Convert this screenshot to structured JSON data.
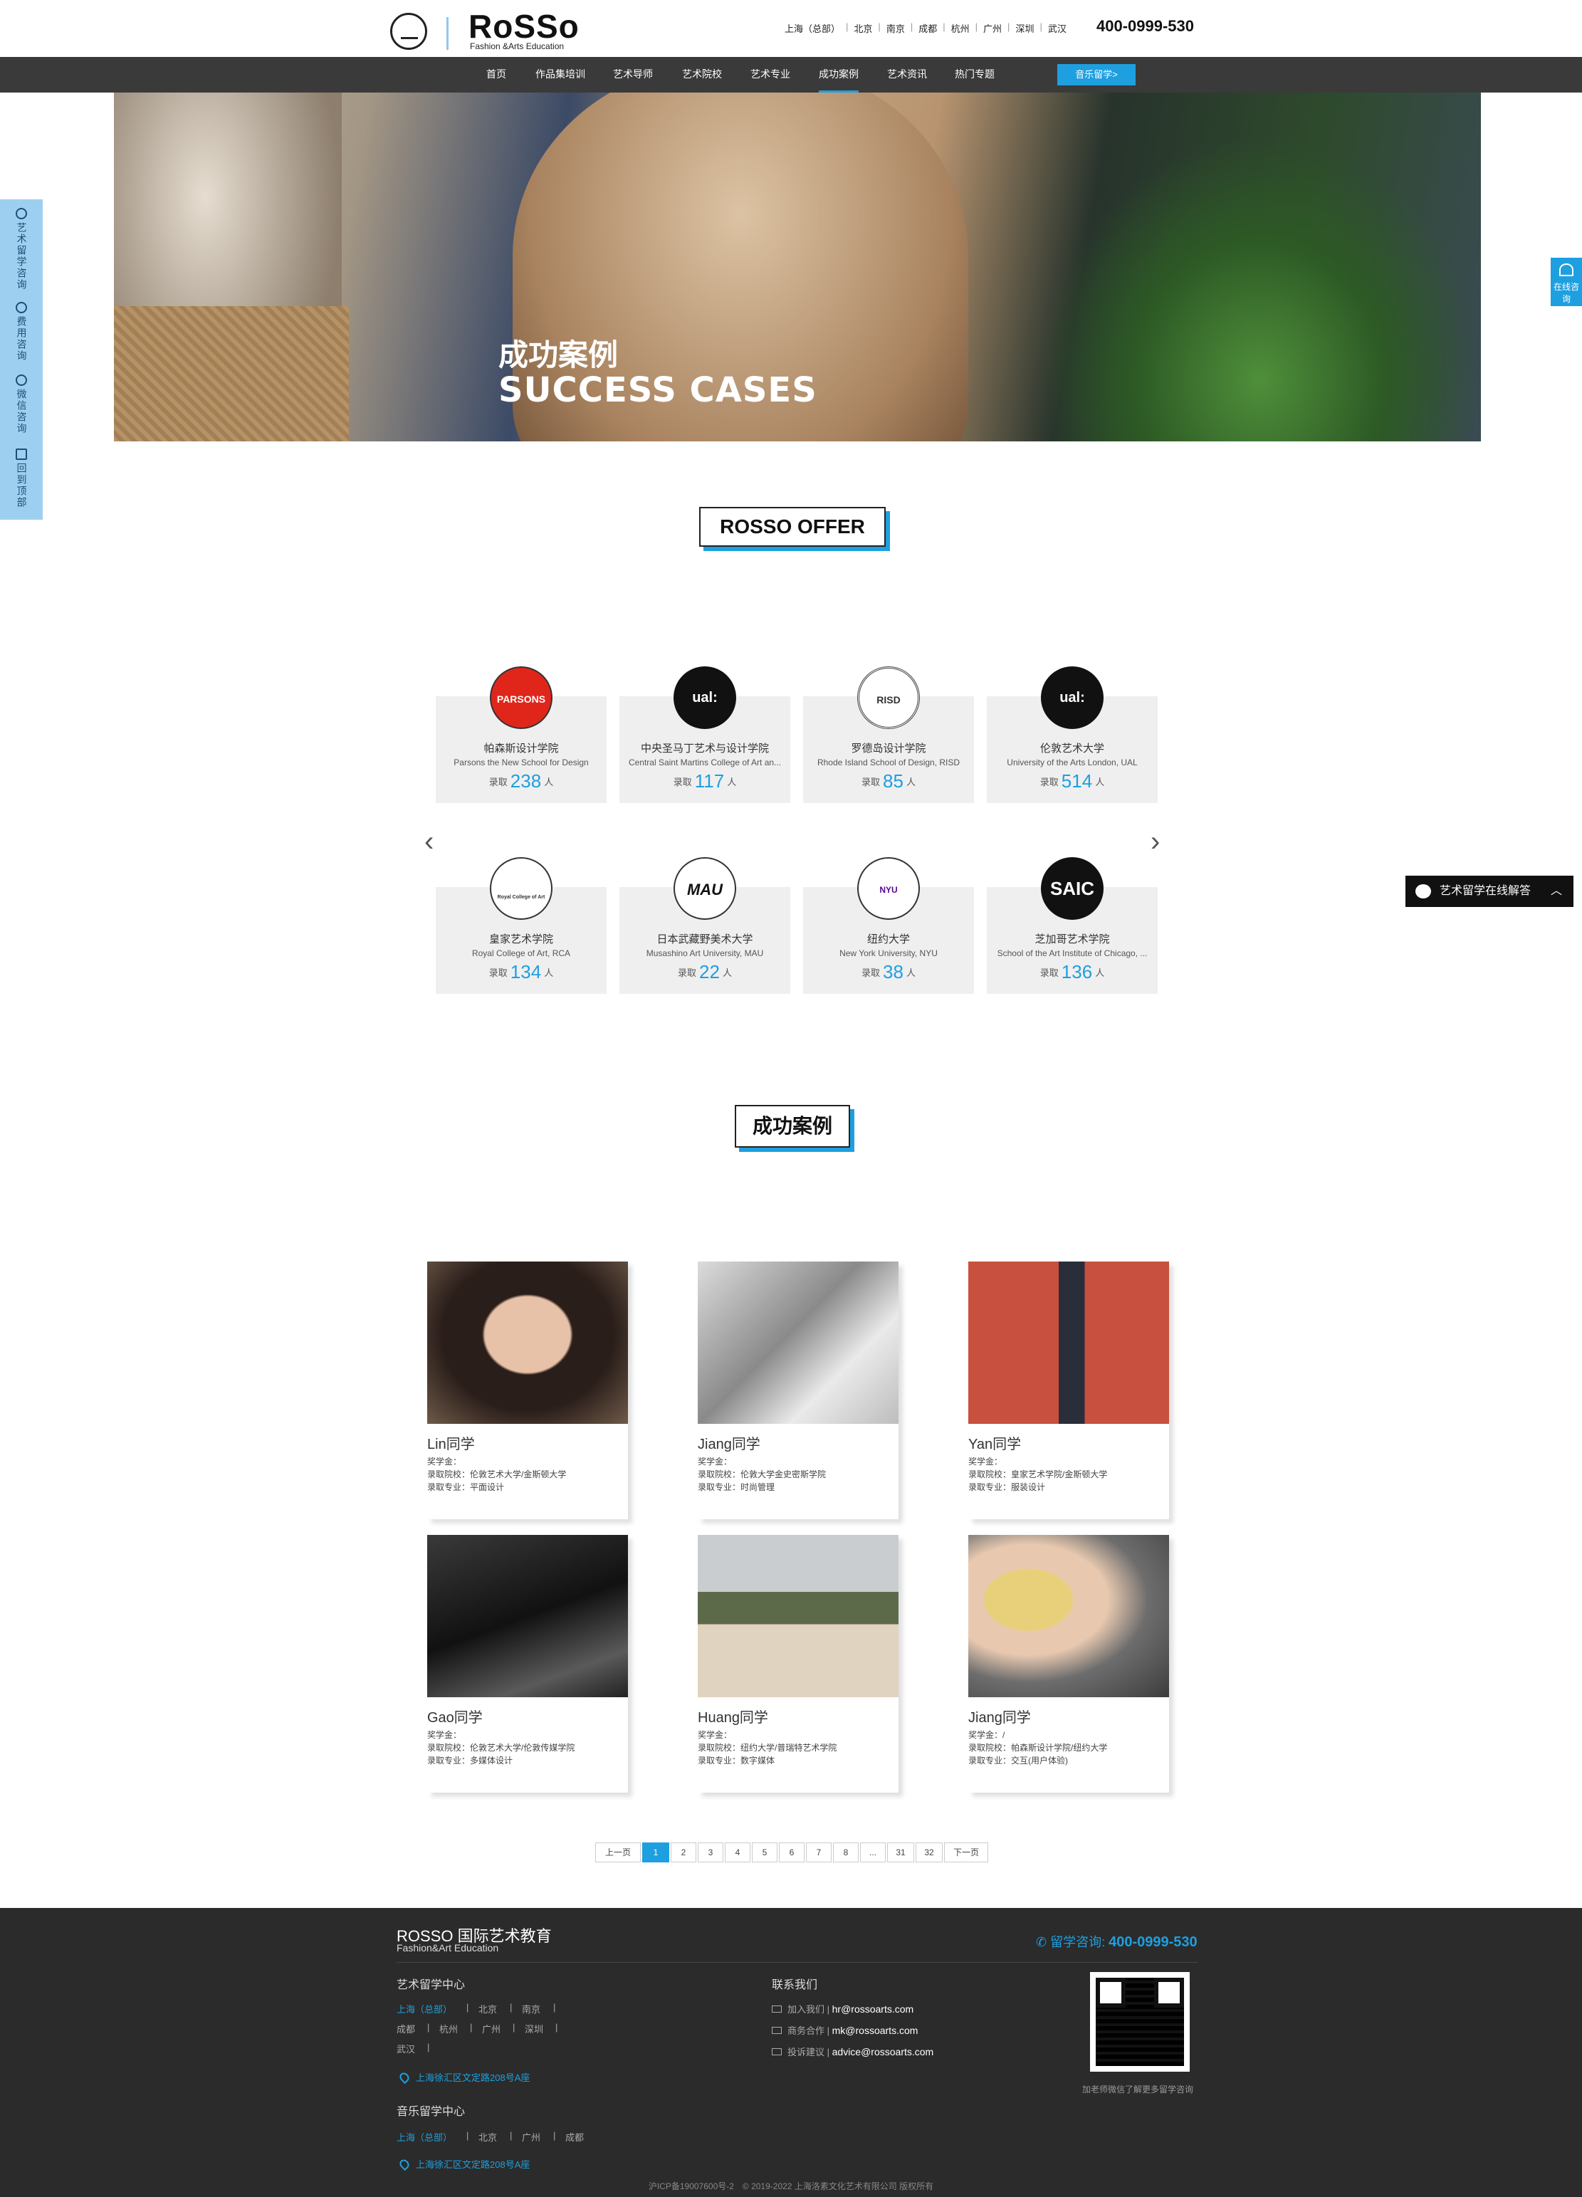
{
  "header": {
    "logo_text": "RoSSo",
    "logo_sub": "Fashion &Arts Education",
    "cities": [
      "上海（总部）",
      "北京",
      "南京",
      "成都",
      "杭州",
      "广州",
      "深圳",
      "武汉"
    ],
    "phone": "400-0999-530"
  },
  "nav": {
    "items": [
      "首页",
      "作品集培训",
      "艺术导师",
      "艺术院校",
      "艺术专业",
      "成功案例",
      "艺术资讯",
      "热门专题"
    ],
    "active_index": 5,
    "music_button": "音乐留学>"
  },
  "hero": {
    "title_cn": "成功案例",
    "title_en": "SUCCESS CASES"
  },
  "sidebar_left": [
    "艺术留学咨询",
    "费用咨询",
    "微信咨询",
    "回到顶部"
  ],
  "sidebar_right": {
    "label": "在线咨询"
  },
  "chat_widget": {
    "label": "艺术留学在线解答",
    "toggle": "︿"
  },
  "offer_section": {
    "title": "ROSSO OFFER",
    "count_prefix": "录取",
    "count_suffix": "人",
    "schools": [
      {
        "cn": "帕森斯设计学院",
        "en": "Parsons the New School for Design",
        "count": "238",
        "logo_text": "PARSONS"
      },
      {
        "cn": "中央圣马丁艺术与设计学院",
        "en": "Central Saint Martins College of Art an...",
        "count": "117",
        "logo_text": "ual:"
      },
      {
        "cn": "罗德岛设计学院",
        "en": "Rhode Island School of Design, RISD",
        "count": "85",
        "logo_text": "RISD"
      },
      {
        "cn": "伦敦艺术大学",
        "en": "University of the Arts London, UAL",
        "count": "514",
        "logo_text": "ual:"
      },
      {
        "cn": "皇家艺术学院",
        "en": "Royal College of Art, RCA",
        "count": "134",
        "logo_text": "Royal College of Art"
      },
      {
        "cn": "日本武藏野美术大学",
        "en": "Musashino Art University, MAU",
        "count": "22",
        "logo_text": "MAU"
      },
      {
        "cn": "纽约大学",
        "en": "New York University, NYU",
        "count": "38",
        "logo_text": "NYU"
      },
      {
        "cn": "芝加哥艺术学院",
        "en": "School of the Art Institute of Chicago, ...",
        "count": "136",
        "logo_text": "SAIC"
      }
    ],
    "prev_arrow": "‹",
    "next_arrow": "›"
  },
  "cases_section": {
    "title": "成功案例",
    "cases": [
      {
        "name": "Lin同学",
        "scholarship": "奖学金：",
        "school": "录取院校：伦敦艺术大学/金斯顿大学",
        "major": "录取专业：平面设计"
      },
      {
        "name": "Jiang同学",
        "scholarship": "奖学金：",
        "school": "录取院校：伦敦大学金史密斯学院",
        "major": "录取专业：时尚管理"
      },
      {
        "name": "Yan同学",
        "scholarship": "奖学金：",
        "school": "录取院校：皇家艺术学院/金斯顿大学",
        "major": "录取专业：服装设计"
      },
      {
        "name": "Gao同学",
        "scholarship": "奖学金：",
        "school": "录取院校：伦敦艺术大学/伦敦传媒学院",
        "major": "录取专业：多媒体设计"
      },
      {
        "name": "Huang同学",
        "scholarship": "奖学金：",
        "school": "录取院校：纽约大学/普瑞特艺术学院",
        "major": "录取专业：数字媒体"
      },
      {
        "name": "Jiang同学",
        "scholarship": "奖学金：/",
        "school": "录取院校：帕森斯设计学院/纽约大学",
        "major": "录取专业：交互(用户体验)"
      }
    ]
  },
  "pagination": {
    "prev": "上一页",
    "pages": [
      "1",
      "2",
      "3",
      "4",
      "5",
      "6",
      "7",
      "8",
      "...",
      "31",
      "32"
    ],
    "current": "1",
    "next": "下一页"
  },
  "footer": {
    "brand": "ROSSO 国际艺术教育",
    "brand_sub": "Fashion&Art Education",
    "hotline_label": "留学咨询:",
    "hotline": "400-0999-530",
    "art_center_title": "艺术留学中心",
    "art_cities": [
      "上海（总部）",
      "北京",
      "南京",
      "成都",
      "杭州",
      "广州",
      "深圳",
      "武汉"
    ],
    "art_address": "上海徐汇区文定路208号A座",
    "music_center_title": "音乐留学中心",
    "music_cities": [
      "上海（总部）",
      "北京",
      "广州",
      "成都"
    ],
    "music_address": "上海徐汇区文定路208号A座",
    "contact_title": "联系我们",
    "contacts": [
      {
        "label": "加入我们",
        "email": "hr@rossoarts.com"
      },
      {
        "label": "商务合作",
        "email": "mk@rossoarts.com"
      },
      {
        "label": "投诉建议",
        "email": "advice@rossoarts.com"
      }
    ],
    "qr_caption": "加老师微信了解更多留学咨询",
    "copyright": "沪ICP备19007600号-2　© 2019-2022 上海洛素文化艺术有限公司 版权所有"
  },
  "colors": {
    "accent": "#1e9fe0",
    "nav_bg": "#3a3a3a",
    "footer_bg": "#2b2b2b",
    "sidebar_bg": "#9dd0f0"
  }
}
